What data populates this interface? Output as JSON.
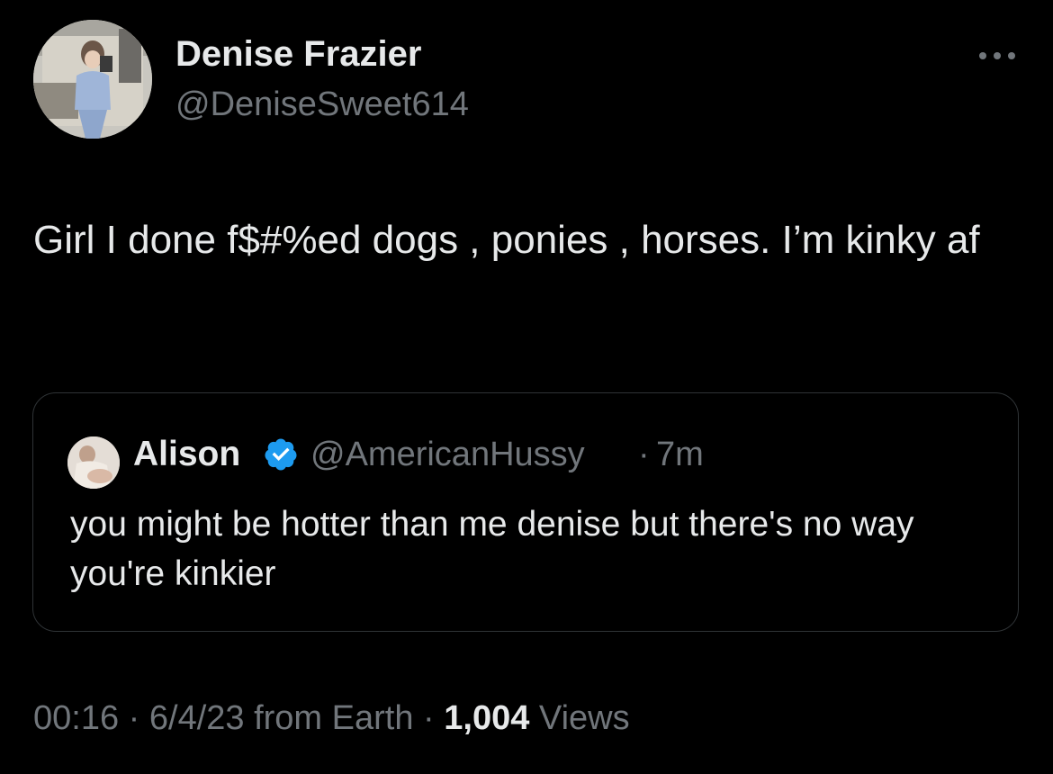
{
  "author": {
    "display_name": "Denise Frazier",
    "handle": "@DeniseSweet614"
  },
  "tweet": {
    "text": "Girl I done f$#%ed dogs , ponies , horses. I’m kinky af"
  },
  "quoted_tweet": {
    "display_name": "Alison",
    "verified": true,
    "handle": "@AmericanHussy",
    "separator": "·",
    "time": "7m",
    "text": "you might be hotter than me denise but there's no way you're kinkier"
  },
  "meta": {
    "time": "00:16",
    "sep1": " · ",
    "date": "6/4/23",
    "source": " from Earth",
    "sep2": " · ",
    "views_count": "1,004",
    "views_label": " Views"
  },
  "icons": {
    "more": "more-horizontal-icon",
    "verified": "verified-badge-icon"
  },
  "colors": {
    "background": "#000000",
    "primary_text": "#e7e9ea",
    "secondary_text": "#71767b",
    "border": "#2f3336",
    "verified_blue": "#1d9bf0"
  }
}
